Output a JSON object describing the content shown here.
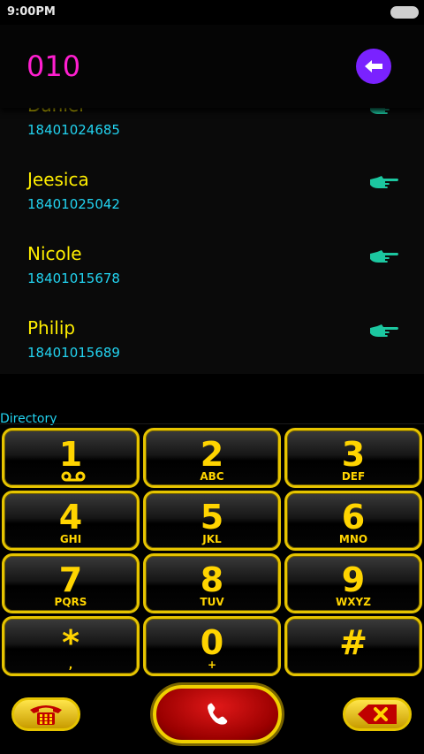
{
  "status_bar": {
    "time": "9:00PM"
  },
  "header": {
    "dialed_number": "010"
  },
  "contacts": [
    {
      "name": "Daniel",
      "number": "18401024685"
    },
    {
      "name": "Jeesica",
      "number": "18401025042"
    },
    {
      "name": "Nicole",
      "number": "18401015678"
    },
    {
      "name": "Philip",
      "number": "18401015689"
    }
  ],
  "directory_label": "Directory",
  "keypad": [
    {
      "digit": "1",
      "letters": ""
    },
    {
      "digit": "2",
      "letters": "ABC"
    },
    {
      "digit": "3",
      "letters": "DEF"
    },
    {
      "digit": "4",
      "letters": "GHI"
    },
    {
      "digit": "5",
      "letters": "JKL"
    },
    {
      "digit": "6",
      "letters": "MNO"
    },
    {
      "digit": "7",
      "letters": "PQRS"
    },
    {
      "digit": "8",
      "letters": "TUV"
    },
    {
      "digit": "9",
      "letters": "WXYZ"
    },
    {
      "digit": "*",
      "letters": ","
    },
    {
      "digit": "0",
      "letters": "+"
    },
    {
      "digit": "#",
      "letters": ""
    }
  ],
  "colors": {
    "accent_yellow": "#ffd400",
    "dial_magenta": "#ff1fd0",
    "number_cyan": "#22d3f0",
    "back_purple": "#7a22ff",
    "call_red": "#c40000"
  },
  "icons": {
    "voicemail": "voicemail-icon",
    "back": "arrow-left-icon",
    "point": "pointing-hand-icon",
    "phone": "phone-handset-icon",
    "directory": "old-phone-icon",
    "delete": "backspace-x-icon"
  }
}
